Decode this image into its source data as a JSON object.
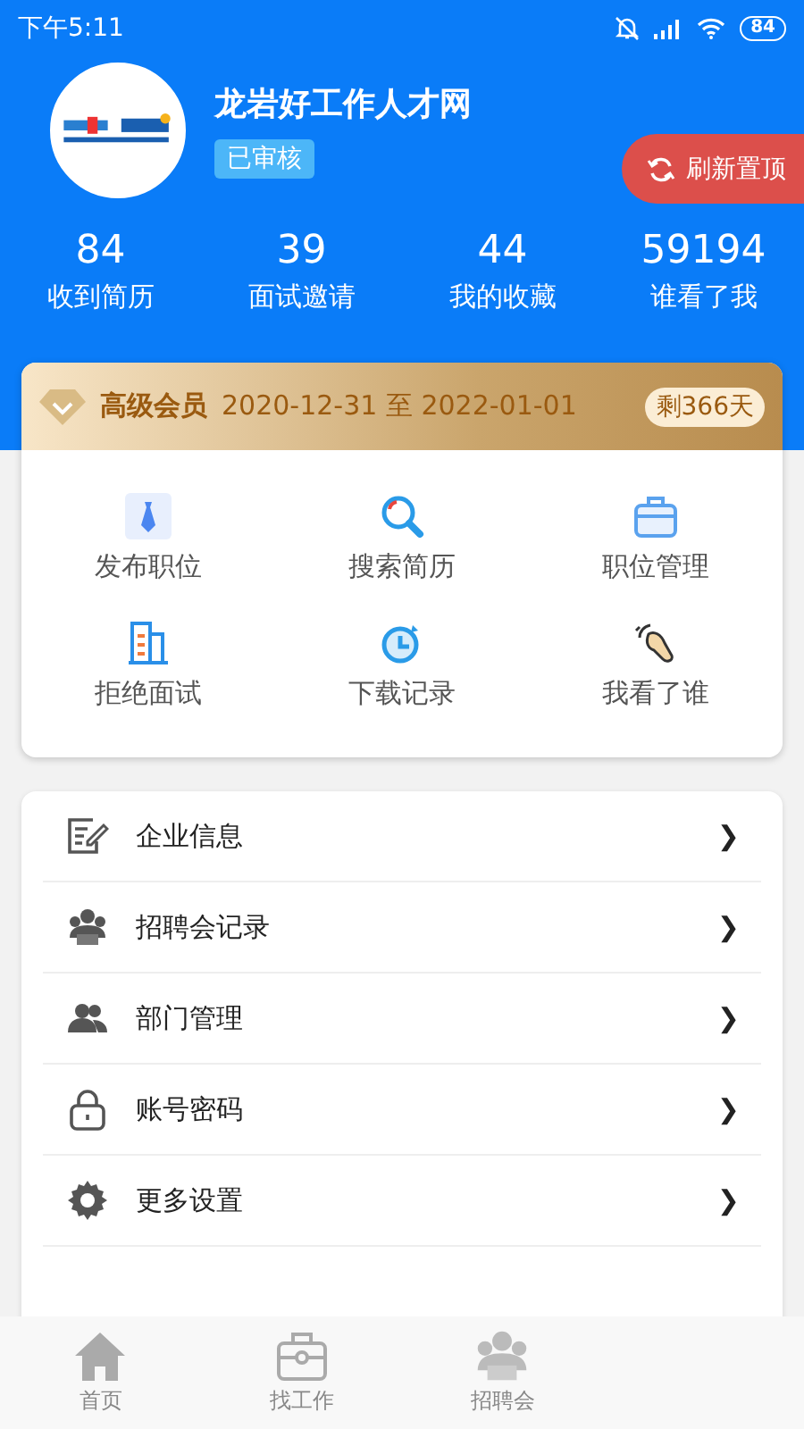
{
  "status_bar": {
    "time": "下午5:11",
    "battery": "84"
  },
  "profile": {
    "name": "龙岩好工作人才网",
    "badge": "已审核",
    "refresh_button": "刷新置顶"
  },
  "stats": [
    {
      "value": "84",
      "label": "收到简历"
    },
    {
      "value": "39",
      "label": "面试邀请"
    },
    {
      "value": "44",
      "label": "我的收藏"
    },
    {
      "value": "59194",
      "label": "谁看了我"
    }
  ],
  "membership": {
    "level": "高级会员",
    "period": "2020-12-31 至 2022-01-01",
    "remaining": "剩366天"
  },
  "shortcuts": [
    {
      "kind": "tie",
      "label": "发布职位"
    },
    {
      "kind": "search",
      "label": "搜索简历"
    },
    {
      "kind": "briefcase",
      "label": "职位管理"
    },
    {
      "kind": "building",
      "label": "拒绝面试"
    },
    {
      "kind": "clock",
      "label": "下载记录"
    },
    {
      "kind": "hand",
      "label": "我看了谁"
    }
  ],
  "menu": [
    {
      "kind": "edit",
      "label": "企业信息",
      "arrow": "❯"
    },
    {
      "kind": "job",
      "label": "招聘会记录",
      "arrow": "❯"
    },
    {
      "kind": "people",
      "label": "部门管理",
      "arrow": "❯"
    },
    {
      "kind": "lock",
      "label": "账号密码",
      "arrow": "❯"
    },
    {
      "kind": "gear",
      "label": "更多设置",
      "arrow": "❯"
    }
  ],
  "tab_bar": [
    {
      "kind": "home",
      "label": "首页"
    },
    {
      "kind": "briefcase",
      "label": "找工作"
    },
    {
      "kind": "job",
      "label": "招聘会"
    }
  ]
}
